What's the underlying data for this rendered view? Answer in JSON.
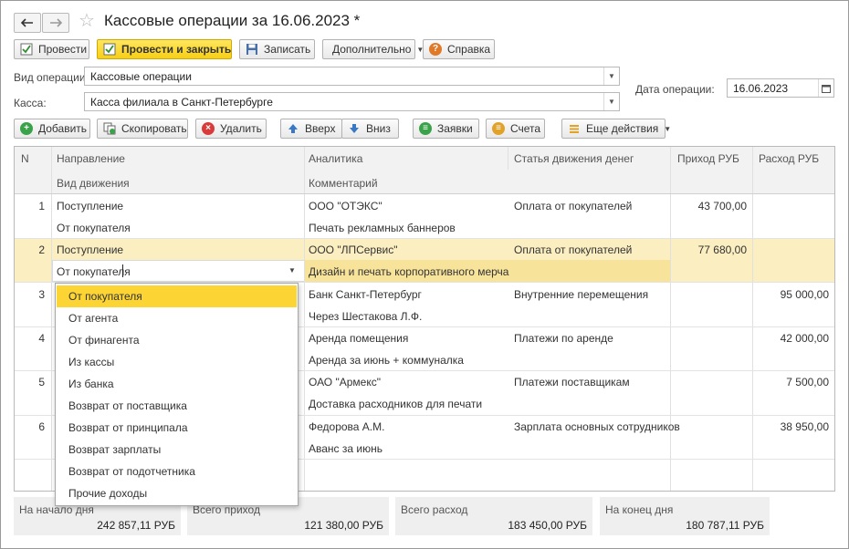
{
  "window": {
    "title": "Кассовые операции за 16.06.2023 *"
  },
  "toolbar": {
    "post": "Провести",
    "post_close": "Провести и закрыть",
    "save": "Записать",
    "more": "Дополнительно",
    "help": "Справка"
  },
  "form": {
    "op_type_label": "Вид операции:",
    "op_type_value": "Кассовые операции",
    "cash_label": "Касса:",
    "cash_value": "Касса филиала в Санкт-Петербурге",
    "date_label": "Дата операции:",
    "date_value": "16.06.2023"
  },
  "table_toolbar": {
    "add": "Добавить",
    "copy": "Скопировать",
    "delete": "Удалить",
    "up": "Вверх",
    "down": "Вниз",
    "requests": "Заявки",
    "invoices": "Счета",
    "more_actions": "Еще действия"
  },
  "table": {
    "headers": {
      "n": "N",
      "direction": "Направление",
      "movement": "Вид движения",
      "analytics": "Аналитика",
      "comment": "Комментарий",
      "article": "Статья движения денег",
      "income": "Приход РУБ",
      "expense": "Расход РУБ"
    },
    "rows": [
      {
        "n": "1",
        "direction": "Поступление",
        "movement": "От покупателя",
        "analytics": "ООО \"ОТЭКС\"",
        "comment": "Печать рекламных баннеров",
        "article": "Оплата от покупателей",
        "income": "43 700,00",
        "expense": ""
      },
      {
        "n": "2",
        "direction": "Поступление",
        "movement": "От покупателя",
        "analytics": "ООО \"ЛПСервис\"",
        "comment": "Дизайн и печать корпоративного мерча",
        "article": "Оплата от покупателей",
        "income": "77 680,00",
        "expense": ""
      },
      {
        "n": "3",
        "direction": "",
        "movement": "",
        "analytics": "Банк Санкт-Петербург",
        "comment": "Через Шестакова Л.Ф.",
        "article": "Внутренние перемещения",
        "income": "",
        "expense": "95 000,00"
      },
      {
        "n": "4",
        "direction": "",
        "movement": "",
        "analytics": "Аренда помещения",
        "comment": "Аренда за июнь + коммуналка",
        "article": "Платежи по аренде",
        "income": "",
        "expense": "42 000,00"
      },
      {
        "n": "5",
        "direction": "",
        "movement": "",
        "analytics": "ОАО \"Армекс\"",
        "comment": "Доставка расходников для печати",
        "article": "Платежи поставщикам",
        "income": "",
        "expense": "7 500,00"
      },
      {
        "n": "6",
        "direction": "",
        "movement": "",
        "analytics": "Федорова А.М.",
        "comment": "Аванс за июнь",
        "article": "Зарплата основных сотрудников",
        "income": "",
        "expense": "38 950,00"
      }
    ]
  },
  "dropdown": {
    "items": [
      "От покупателя",
      "От агента",
      "От финагента",
      "Из кассы",
      "Из банка",
      "Возврат от поставщика",
      "Возврат от принципала",
      "Возврат зарплаты",
      "Возврат от подотчетника",
      "Прочие доходы"
    ],
    "selected": "От покупателя"
  },
  "totals": [
    {
      "label": "На начало дня",
      "value": "242 857,11 РУБ"
    },
    {
      "label": "Всего приход",
      "value": "121 380,00 РУБ"
    },
    {
      "label": "Всего расход",
      "value": "183 450,00 РУБ"
    },
    {
      "label": "На конец дня",
      "value": "180 787,11 РУБ"
    }
  ],
  "colors": {
    "accent": "#f7cf17",
    "selected_row": "#fbeec0",
    "selected_cell": "#f8e39a",
    "dropdown_selected": "#fcd535"
  }
}
